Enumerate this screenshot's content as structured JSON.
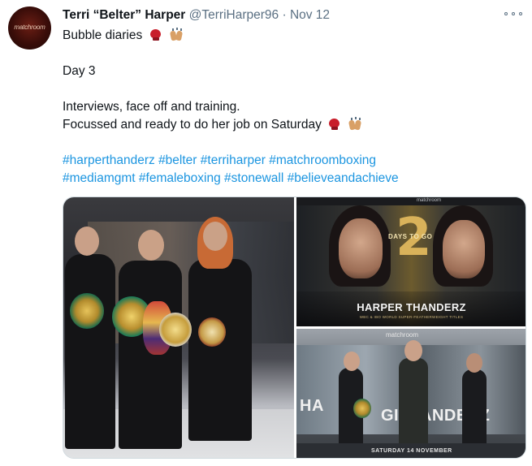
{
  "author": {
    "display_name": "Terri “Belter” Harper",
    "handle": "@TerriHarper96",
    "separator": "·",
    "date": "Nov 12",
    "avatar_text": "matchroom"
  },
  "tweet": {
    "line1": "Bubble diaries",
    "line2": "Day 3",
    "line3": "Interviews, face off and training.",
    "line4": "Focussed and ready to do her job on Saturday",
    "hashtags_row1": [
      "#harperthanderz",
      "#belter",
      "#terriharper",
      "#matchroomboxing"
    ],
    "hashtags_row2": [
      "#mediamgmt",
      "#femaleboxing",
      "#stonewall",
      "#believeandachieve"
    ]
  },
  "media": {
    "photo2": {
      "big_number": "2",
      "days_label": "DAYS TO GO",
      "title": "HARPER THANDERZ",
      "subtitle": "WBC & IBO WORLD SUPER-FEATHERWEIGHT TITLES",
      "top_label": "matchroom"
    },
    "photo3": {
      "text_left": "HA",
      "text_right": "ANDERZ",
      "text_mid": "GI",
      "date_text": "SATURDAY 14 NOVEMBER",
      "logo": "matchroom"
    }
  },
  "colors": {
    "text_primary": "#0f1419",
    "text_secondary": "#5b7083",
    "link": "#1b95e0",
    "border": "#cfd9de"
  },
  "icons": [
    "more-icon",
    "boxing-glove-icon",
    "clapping-hands-icon"
  ]
}
